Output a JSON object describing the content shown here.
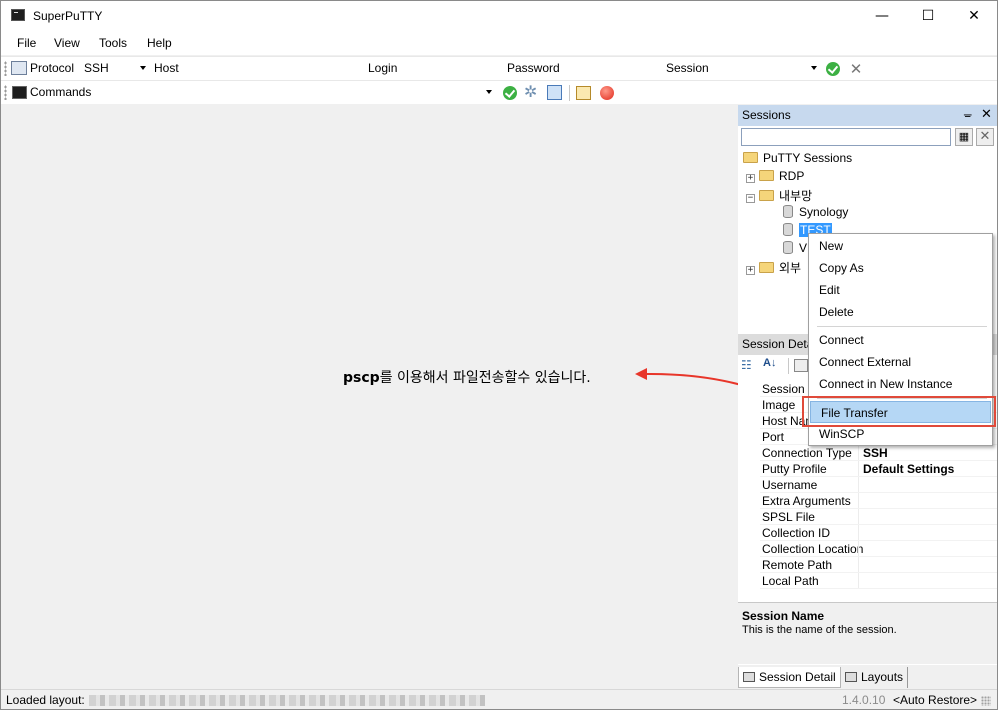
{
  "window": {
    "title": "SuperPuTTY",
    "controls": {
      "minimize": "—",
      "maximize": "☐",
      "close": "✕"
    }
  },
  "menu": [
    "File",
    "View",
    "Tools",
    "Help"
  ],
  "connection_bar": {
    "protocol_label": "Protocol",
    "protocol_value": "SSH",
    "host_label": "Host",
    "host_value": "",
    "login_label": "Login",
    "login_value": "",
    "password_label": "Password",
    "password_value": "",
    "session_label": "Session",
    "session_value": ""
  },
  "commands_bar": {
    "label": "Commands",
    "value": ""
  },
  "annotation": {
    "bold": "pscp",
    "rest": "를 이용해서 파일전송할수 있습니다."
  },
  "sessions_panel": {
    "title": "Sessions",
    "pin": "📌",
    "close": "✕",
    "search_value": "",
    "tree": {
      "root": "PuTTY Sessions",
      "items": [
        {
          "label": "RDP",
          "type": "folder",
          "expander": "+"
        },
        {
          "label": "내부망",
          "type": "folder",
          "expander": "−"
        },
        {
          "label": "Synology",
          "type": "session"
        },
        {
          "label": "TEST",
          "type": "session",
          "selected": true
        },
        {
          "label": "V",
          "type": "session"
        },
        {
          "label": "외부",
          "type": "folder",
          "expander": "+"
        }
      ]
    }
  },
  "context_menu": {
    "group1": [
      "New",
      "Copy As",
      "Edit",
      "Delete"
    ],
    "group2": [
      "Connect",
      "Connect External",
      "Connect in New Instance"
    ],
    "group3": [
      "File Transfer",
      "WinSCP"
    ],
    "highlighted": "File Transfer"
  },
  "session_detail": {
    "title": "Session Detai",
    "properties": [
      {
        "name": "Session N",
        "value": ""
      },
      {
        "name": "Image",
        "value": ""
      },
      {
        "name": "Host Nam",
        "value": ""
      },
      {
        "name": "Port",
        "value": ""
      },
      {
        "name": "Connection Type",
        "value": "SSH"
      },
      {
        "name": "Putty Profile",
        "value": "Default Settings"
      },
      {
        "name": "Username",
        "value": ""
      },
      {
        "name": "Extra Arguments",
        "value": ""
      },
      {
        "name": "SPSL File",
        "value": ""
      },
      {
        "name": "Collection ID",
        "value": ""
      },
      {
        "name": "Collection Location",
        "value": ""
      },
      {
        "name": "Remote Path",
        "value": ""
      },
      {
        "name": "Local Path",
        "value": ""
      }
    ],
    "desc_title": "Session Name",
    "desc_text": "This is the name of the session."
  },
  "bottom_tabs": [
    "Session Detail",
    "Layouts"
  ],
  "status": {
    "loaded_label": "Loaded layout:",
    "version": "1.4.0.10",
    "auto_restore": "<Auto Restore>"
  },
  "colors": {
    "panel_header": "#c7d9ee",
    "highlight": "#b5d7f5",
    "annotation_red": "#e8362a",
    "selection": "#3399ff"
  }
}
